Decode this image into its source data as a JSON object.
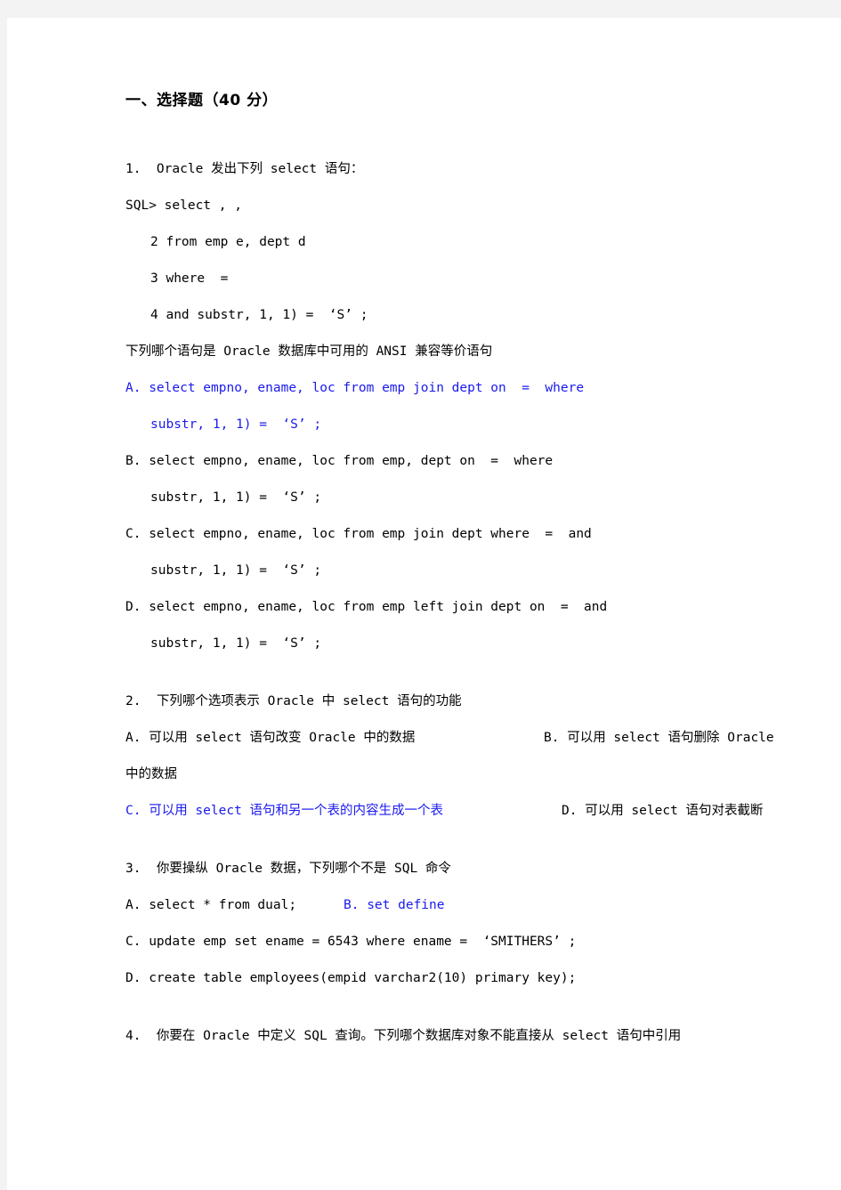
{
  "document": {
    "background_color": "#f3f3f3",
    "page_color": "#ffffff",
    "answer_color": "#1a1aee",
    "text_color": "#000000",
    "section_title": "一、选择题（40 分）"
  },
  "questions": [
    {
      "number": "1.",
      "stem": "1.  Oracle 发出下列 select 语句：",
      "code": [
        "SQL> select , ,",
        "2 from emp e, dept d",
        "3 where  =",
        "4 and substr, 1, 1) =  ‘S’ ;"
      ],
      "sub_prompt": "下列哪个语句是 Oracle 数据库中可用的 ANSI 兼容等价语句",
      "options": [
        {
          "label": "A.",
          "line1": "A. select empno, ename, loc from emp join dept on  =  where",
          "line2": "substr, 1, 1) =  ‘S’ ;",
          "highlighted": true
        },
        {
          "label": "B.",
          "line1": "B. select empno, ename, loc from emp, dept on  =  where",
          "line2": "substr, 1, 1) =  ‘S’ ;",
          "highlighted": false
        },
        {
          "label": "C.",
          "line1": "C. select empno, ename, loc from emp join dept where  =  and",
          "line2": "substr, 1, 1) =  ‘S’ ;",
          "highlighted": false
        },
        {
          "label": "D.",
          "line1": "D. select empno, ename, loc from emp left join dept on  =  and",
          "line2": "substr, 1, 1) =  ‘S’ ;",
          "highlighted": false
        }
      ]
    },
    {
      "number": "2.",
      "stem": "2.  下列哪个选项表示 Oracle 中 select 语句的功能",
      "row1_left": "A. 可以用 select 语句改变 Oracle 中的数据",
      "row1_right": "B. 可以用 select 语句删除 Oracle",
      "row1_wrap": "中的数据",
      "row2_left": "C. 可以用 select 语句和另一个表的内容生成一个表",
      "row2_right": "D. 可以用 select 语句对表截断",
      "row2_left_highlighted": true
    },
    {
      "number": "3.",
      "stem": "3.  你要操纵 Oracle 数据，下列哪个不是 SQL 命令",
      "row1_left": "A. select * from dual;",
      "row1_right": "B. set define",
      "row1_right_highlighted": true,
      "option_c": "C. update emp set ename = 6543 where ename =  ‘SMITHERS’ ;",
      "option_d": "D. create table employees(empid varchar2(10) primary key);"
    },
    {
      "number": "4.",
      "stem": "4.  你要在 Oracle 中定义 SQL 查询。下列哪个数据库对象不能直接从 select 语句中引用"
    }
  ]
}
